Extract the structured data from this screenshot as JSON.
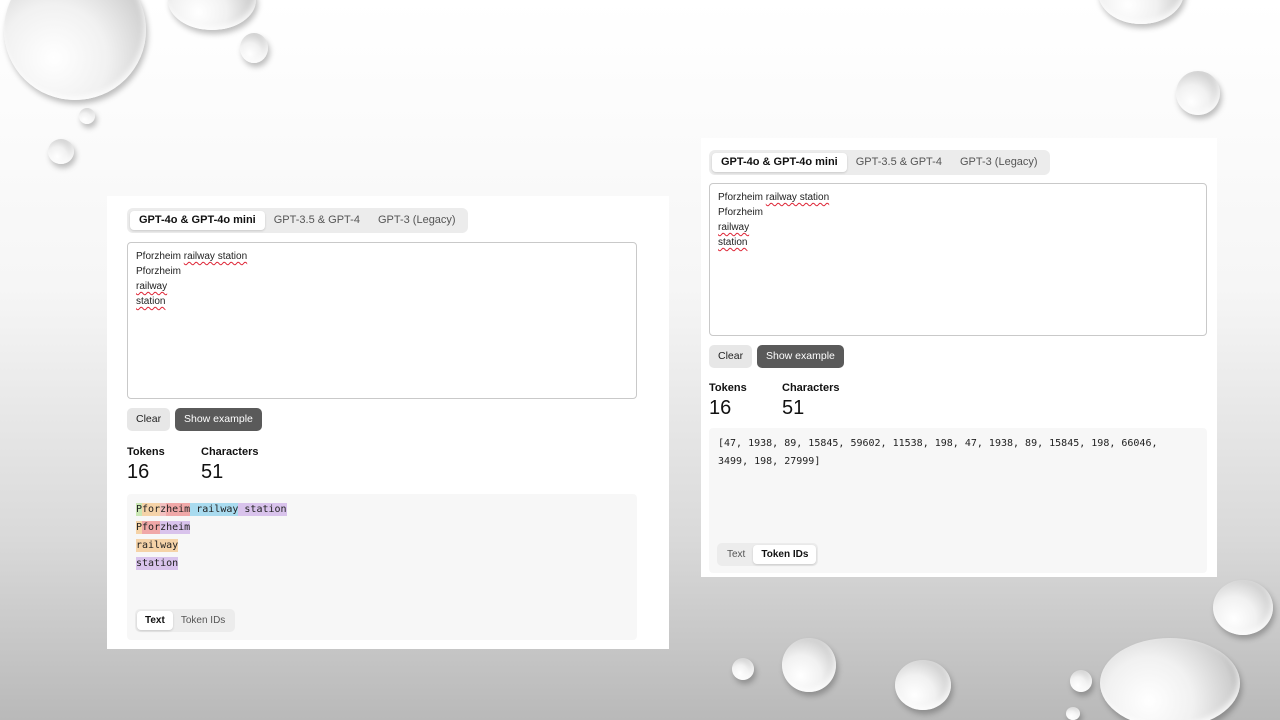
{
  "model_tabs": [
    "GPT-4o & GPT-4o mini",
    "GPT-3.5 & GPT-4",
    "GPT-3 (Legacy)"
  ],
  "input_lines": [
    [
      {
        "t": "Pforzheim "
      },
      {
        "t": "railway station",
        "spell": true
      }
    ],
    [
      {
        "t": "Pforzheim"
      }
    ],
    [
      {
        "t": "railway",
        "spell": true
      }
    ],
    [
      {
        "t": "station",
        "spell": true
      }
    ]
  ],
  "buttons": {
    "clear": "Clear",
    "show_example": "Show example"
  },
  "stats": {
    "tokens_label": "Tokens",
    "tokens_value": "16",
    "characters_label": "Characters",
    "characters_value": "51"
  },
  "tokens_text": [
    [
      {
        "t": "P",
        "c": "#c9e6b3"
      },
      {
        "t": "for",
        "c": "#f5d3a8"
      },
      {
        "t": "z",
        "c": "#f3c0c0"
      },
      {
        "t": "heim",
        "c": "#f0a8a8"
      },
      {
        "t": " railway",
        "c": "#a9dbef"
      },
      {
        "t": " station",
        "c": "#d9c3ec"
      }
    ],
    [
      {
        "t": "P",
        "c": "#f5d3a8"
      },
      {
        "t": "for",
        "c": "#f0a8a8"
      },
      {
        "t": "zheim",
        "c": "#d9c3ec"
      }
    ],
    [
      {
        "t": "railway",
        "c": "#f5d3a8"
      }
    ],
    [
      {
        "t": "station",
        "c": "#d9c3ec"
      }
    ]
  ],
  "token_ids_text": "[47, 1938, 89, 15845, 59602, 11538, 198, 47, 1938, 89, 15845, 198, 66046, 3499, 198, 27999]",
  "view_toggle": [
    "Text",
    "Token IDs"
  ]
}
